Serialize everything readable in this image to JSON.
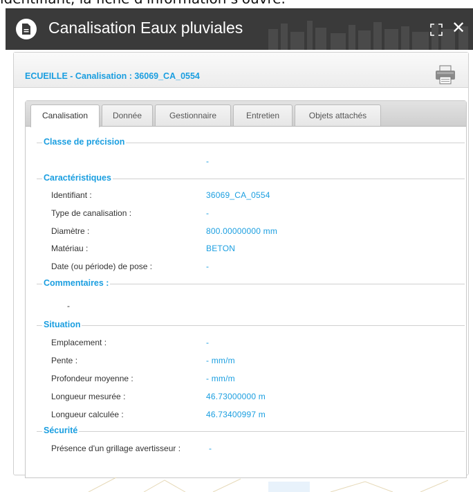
{
  "caption_top": "identifiant, la fiche d'information s'ouvre.",
  "window": {
    "title": "Canalisation Eaux pluviales"
  },
  "record": {
    "header": "ECUEILLE - Canalisation : 36069_CA_0554"
  },
  "tabs": [
    {
      "label": "Canalisation",
      "active": true
    },
    {
      "label": "Donnée",
      "active": false
    },
    {
      "label": "Gestionnaire",
      "active": false
    },
    {
      "label": "Entretien",
      "active": false
    },
    {
      "label": "Objets attachés",
      "active": false
    }
  ],
  "sections": {
    "precision": {
      "legend": "Classe de précision",
      "value": "-"
    },
    "caracteristiques": {
      "legend": "Caractéristiques",
      "rows": [
        {
          "label": "Identifiant :",
          "value": "36069_CA_0554"
        },
        {
          "label": "Type de canalisation :",
          "value": "-"
        },
        {
          "label": "Diamètre :",
          "value": "800.00000000 mm"
        },
        {
          "label": "Matériau :",
          "value": "BETON"
        },
        {
          "label": "Date (ou période) de pose :",
          "value": "-"
        }
      ]
    },
    "commentaires": {
      "legend": "Commentaires :",
      "value": "-"
    },
    "situation": {
      "legend": "Situation",
      "rows": [
        {
          "label": "Emplacement :",
          "value": "-"
        },
        {
          "label": "Pente :",
          "value": "- mm/m"
        },
        {
          "label": "Profondeur moyenne :",
          "value": "- mm/m"
        },
        {
          "label": "Longueur mesurée :",
          "value": "46.73000000 m"
        },
        {
          "label": "Longueur calculée :",
          "value": "46.73400997 m"
        }
      ]
    },
    "securite": {
      "legend": "Sécurité",
      "rows": [
        {
          "label": "Présence d'un grillage avertisseur :",
          "value": "-"
        }
      ]
    }
  },
  "colors": {
    "accent": "#1a9ee0",
    "title_bar": "#3a3a3a",
    "label_text": "#333333"
  },
  "icons": {
    "doc": "document-icon",
    "expand": "expand-icon",
    "close": "close-icon",
    "print": "print-icon"
  }
}
